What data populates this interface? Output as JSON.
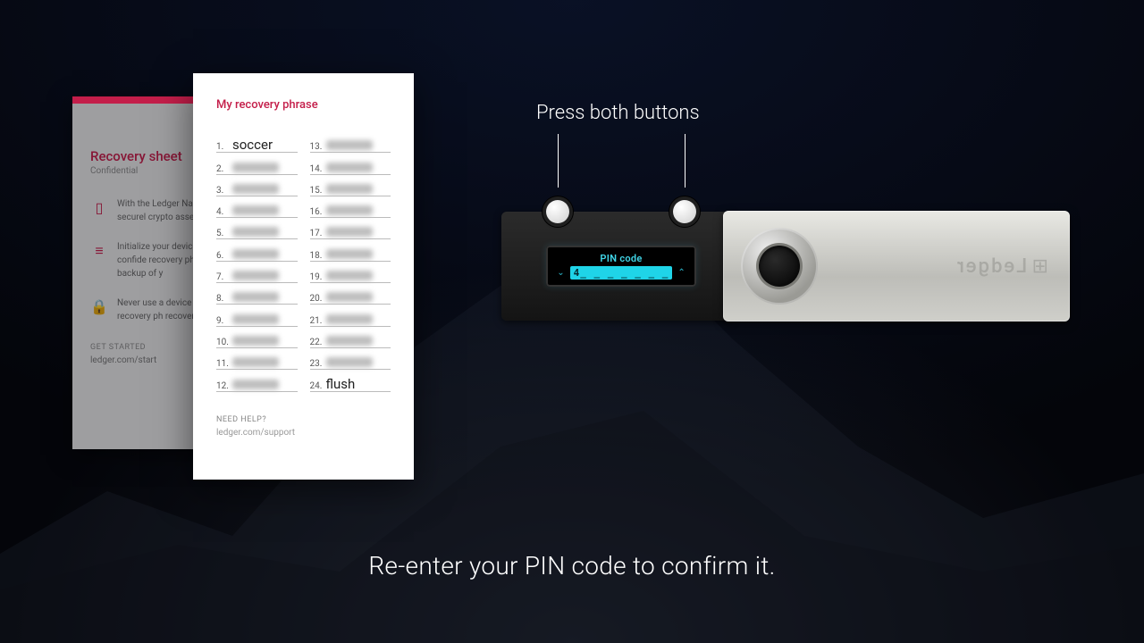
{
  "instruction": "Re-enter your PIN code to confirm it.",
  "press_label": "Press both buttons",
  "device": {
    "brand": "Ledger",
    "screen_title": "PIN code",
    "pin_first_digit": "4",
    "pin_rest": "_ _ _ _ _ _ _"
  },
  "back_sheet": {
    "title": "Recovery sheet",
    "subtitle": "Confidential",
    "row1": "With the Ledger Nano private keys to securel crypto assets.",
    "row2": "Initialize your device to and save your confide recovery phrase. Your is the only backup of y",
    "row3": "Never use a device sup code or a recovery ph recovery sheet(s) in a s",
    "get_started": "GET STARTED",
    "start_url": "ledger.com/start"
  },
  "card": {
    "title": "My recovery phrase",
    "help": "NEED HELP?",
    "help_url": "ledger.com/support",
    "word_1": "soccer",
    "word_24": "flush",
    "n1": "1.",
    "n2": "2.",
    "n3": "3.",
    "n4": "4.",
    "n5": "5.",
    "n6": "6.",
    "n7": "7.",
    "n8": "8.",
    "n9": "9.",
    "n10": "10.",
    "n11": "11.",
    "n12": "12.",
    "n13": "13.",
    "n14": "14.",
    "n15": "15.",
    "n16": "16.",
    "n17": "17.",
    "n18": "18.",
    "n19": "19.",
    "n20": "20.",
    "n21": "21.",
    "n22": "22.",
    "n23": "23.",
    "n24": "24."
  }
}
